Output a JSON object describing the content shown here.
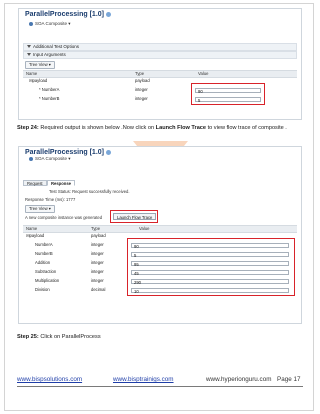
{
  "screenshot1": {
    "title": "ParallelProcessing [1.0]",
    "composite": "SOA Composite",
    "panel_additional": "Additional Test Options",
    "panel_input": "Input Arguments",
    "tree_view": "Tree View",
    "columns": [
      "Name",
      "Type",
      "Value"
    ],
    "rows": [
      {
        "name": "payload",
        "type": "payload",
        "value": ""
      },
      {
        "name": "* NumberA",
        "type": "integer",
        "value": "90"
      },
      {
        "name": "* NumberB",
        "type": "integer",
        "value": "5"
      }
    ]
  },
  "step24": {
    "label": "Step 24:",
    "text_before": " Required output is shown below .Now click on ",
    "bold": "Launch Flow Trace",
    "text_after": " to view flow trace of composite ."
  },
  "screenshot2": {
    "title": "ParallelProcessing [1.0]",
    "composite": "SOA Composite",
    "tabs": [
      "Request",
      "Response"
    ],
    "test_status_label": "Test Status:",
    "test_status_value": "Request successfully received.",
    "response_time": "Response Time (ms): 1777",
    "tree_view": "Tree View",
    "instance_text": "A new composite instance was generated",
    "flow_trace_button": "Launch Flow Trace",
    "columns": [
      "Name",
      "Type",
      "Value"
    ],
    "rows": [
      {
        "name": "payload",
        "type": "payload",
        "value": ""
      },
      {
        "name": "NumberA",
        "type": "integer",
        "value": "90"
      },
      {
        "name": "NumberB",
        "type": "integer",
        "value": "5"
      },
      {
        "name": "Addition",
        "type": "integer",
        "value": "95"
      },
      {
        "name": "Subtraction",
        "type": "integer",
        "value": "45"
      },
      {
        "name": "Multiplication",
        "type": "integer",
        "value": "290"
      },
      {
        "name": "Division",
        "type": "decimal",
        "value": "10"
      }
    ]
  },
  "step25": {
    "label": "Step 25:",
    "text": " Click on ParallelProcess"
  },
  "footer": {
    "link1": "www.bispsolutions.com",
    "link2": "www.bisptrainigs.com",
    "link3": "www.hyperionguru.com",
    "page": "Page 17"
  },
  "colors": {
    "highlight": "#d8232a",
    "arrow": "#f6c7a6",
    "link": "#1f3ea8"
  }
}
